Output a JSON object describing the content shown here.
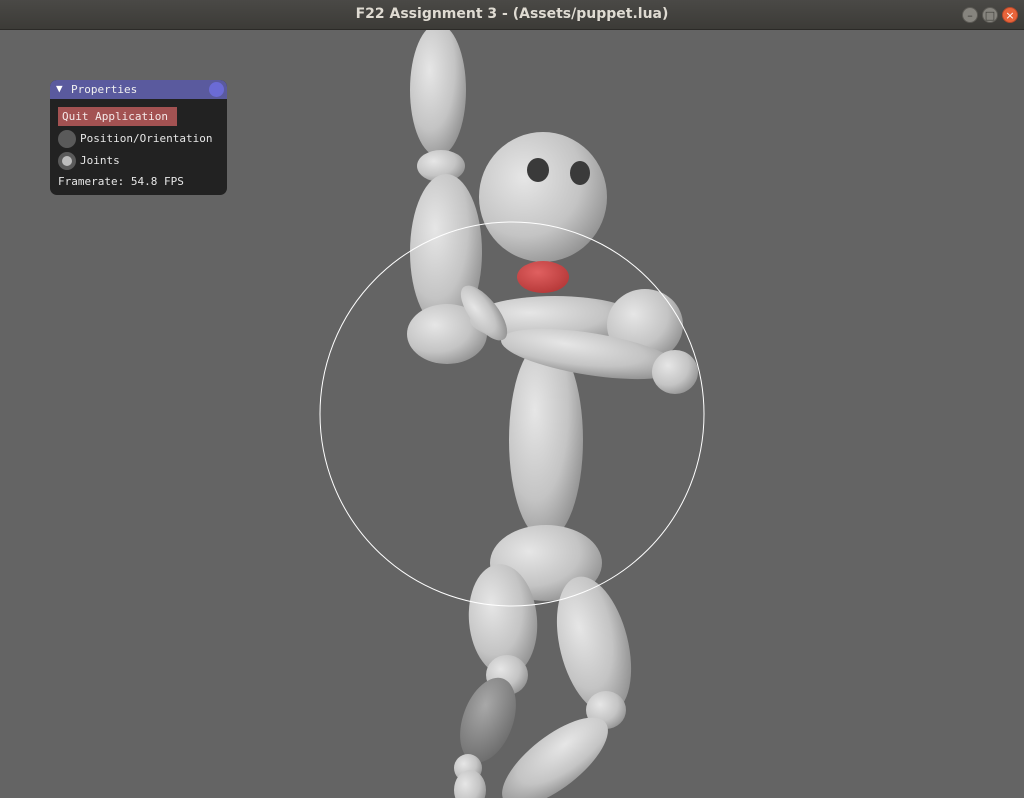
{
  "window": {
    "title": "F22 Assignment 3 - (Assets/puppet.lua)"
  },
  "controls": {
    "minimize_icon": "minimize-icon",
    "maximize_icon": "maximize-icon",
    "close_icon": "close-icon"
  },
  "panel": {
    "title": "Properties",
    "quit_label": "Quit Application",
    "mode_options": [
      {
        "label": "Position/Orientation",
        "selected": false
      },
      {
        "label": "Joints",
        "selected": true
      }
    ],
    "framerate": "Framerate: 54.8 FPS"
  },
  "colors": {
    "background": "#646464",
    "puppet_body": "#d0d0d0",
    "puppet_mouth": "#d14545",
    "panel_header": "#5a5a9e",
    "quit_button": "#a35252"
  }
}
